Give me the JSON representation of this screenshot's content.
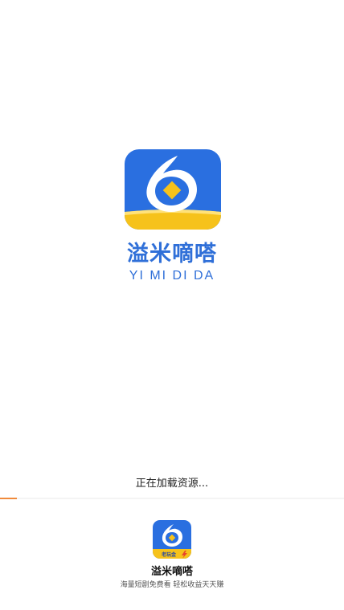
{
  "brand": {
    "name": "溢米嘀嗒",
    "pinyin": "YI MI DI DA",
    "primary_color": "#2f6fd8",
    "accent_color": "#f6c21b"
  },
  "loading": {
    "text": "正在加载资源...",
    "progress_percent": 5,
    "progress_color": "#f08a3c"
  },
  "footer": {
    "app_name": "溢米嘀嗒",
    "slogan": "海量短剧免费看 轻松收益天天赚",
    "badge_label": "老玩金"
  },
  "icons": {
    "main_logo": "yimi-drop-logo-icon",
    "small_logo": "yimi-app-icon"
  }
}
